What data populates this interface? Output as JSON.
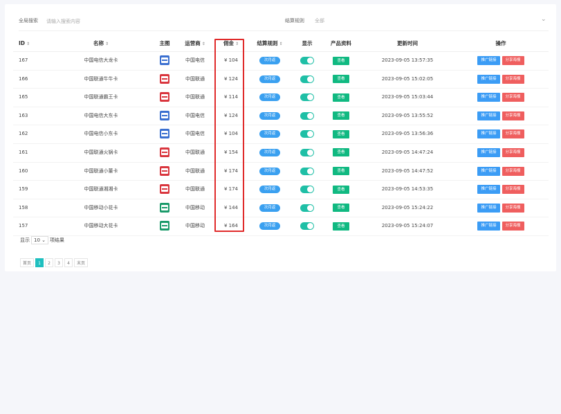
{
  "search": {
    "label": "全局搜索",
    "placeholder": "请输入搜索内容",
    "rule_label": "结算规则",
    "rule_value": "全部"
  },
  "columns": {
    "id": "ID",
    "name": "名称",
    "image": "主图",
    "operator": "运营商",
    "commission": "佣金",
    "rule": "结算规则",
    "show": "显示",
    "product": "产品资料",
    "updated": "更新时间",
    "actions": "操作"
  },
  "rows": [
    {
      "id": "167",
      "name": "中国电信大龙卡",
      "operator": "中国电信",
      "commission": "¥ 104",
      "rule": "次月返",
      "view": "查看",
      "updated": "2023-09-05 13:57:35",
      "promo": "推广链接",
      "share": "分享海报",
      "icon_color": "#3a6fd0"
    },
    {
      "id": "166",
      "name": "中国联通牛牛卡",
      "operator": "中国联通",
      "commission": "¥ 124",
      "rule": "次月返",
      "view": "查看",
      "updated": "2023-09-05 15:02:05",
      "promo": "推广链接",
      "share": "分享海报",
      "icon_color": "#d9363e"
    },
    {
      "id": "165",
      "name": "中国联通霸王卡",
      "operator": "中国联通",
      "commission": "¥ 114",
      "rule": "次月返",
      "view": "查看",
      "updated": "2023-09-05 15:03:44",
      "promo": "推广链接",
      "share": "分享海报",
      "icon_color": "#d9363e"
    },
    {
      "id": "163",
      "name": "中国电信大东卡",
      "operator": "中国电信",
      "commission": "¥ 124",
      "rule": "次月返",
      "view": "查看",
      "updated": "2023-09-05 13:55:52",
      "promo": "推广链接",
      "share": "分享海报",
      "icon_color": "#3a6fd0"
    },
    {
      "id": "162",
      "name": "中国电信小东卡",
      "operator": "中国电信",
      "commission": "¥ 104",
      "rule": "次月返",
      "view": "查看",
      "updated": "2023-09-05 13:56:36",
      "promo": "推广链接",
      "share": "分享海报",
      "icon_color": "#3a6fd0"
    },
    {
      "id": "161",
      "name": "中国联通火锅卡",
      "operator": "中国联通",
      "commission": "¥ 154",
      "rule": "次月返",
      "view": "查看",
      "updated": "2023-09-05 14:47:24",
      "promo": "推广链接",
      "share": "分享海报",
      "icon_color": "#d9363e"
    },
    {
      "id": "160",
      "name": "中国联通小董卡",
      "operator": "中国联通",
      "commission": "¥ 174",
      "rule": "次月返",
      "view": "查看",
      "updated": "2023-09-05 14:47:52",
      "promo": "推广链接",
      "share": "分享海报",
      "icon_color": "#d9363e"
    },
    {
      "id": "159",
      "name": "中国联通湘湘卡",
      "operator": "中国联通",
      "commission": "¥ 174",
      "rule": "次月返",
      "view": "查看",
      "updated": "2023-09-05 14:53:35",
      "promo": "推广链接",
      "share": "分享海报",
      "icon_color": "#d9363e"
    },
    {
      "id": "158",
      "name": "中国移动小花卡",
      "operator": "中国移动",
      "commission": "¥ 144",
      "rule": "次月返",
      "view": "查看",
      "updated": "2023-09-05 15:24:22",
      "promo": "推广链接",
      "share": "分享海报",
      "icon_color": "#1a9a6a"
    },
    {
      "id": "157",
      "name": "中国移动大花卡",
      "operator": "中国移动",
      "commission": "¥ 164",
      "rule": "次月返",
      "view": "查看",
      "updated": "2023-09-05 15:24:07",
      "promo": "推广链接",
      "share": "分享海报",
      "icon_color": "#1a9a6a"
    }
  ],
  "page_size": {
    "prefix": "显示",
    "value": "10",
    "suffix": "项结果"
  },
  "pagination": {
    "first": "首页",
    "pages": [
      "1",
      "2",
      "3",
      "4"
    ],
    "current": "1",
    "last": "末页"
  },
  "colors": {
    "accent": "#1fbfbf",
    "highlight": "#e02a2a"
  }
}
